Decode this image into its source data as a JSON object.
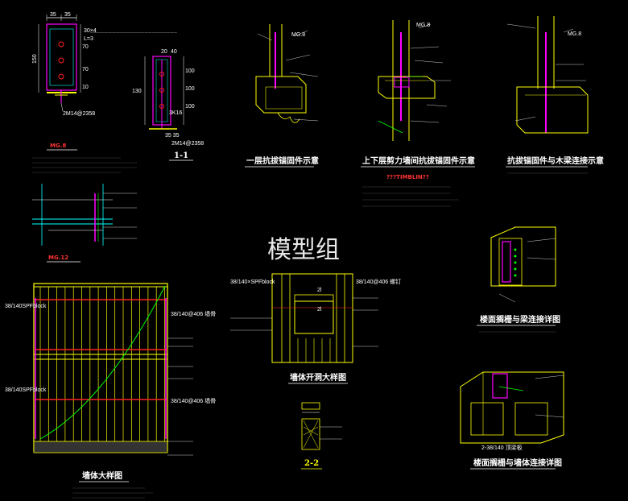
{
  "watermark": "模型组",
  "mg8": {
    "title": "MG.8",
    "dims_top": [
      "35",
      "35"
    ],
    "dims_side": [
      "70",
      "70",
      "10"
    ],
    "height": "150",
    "callout": "2M14@2358",
    "small": "L=3",
    "anno": "30×4"
  },
  "sec11": {
    "title": "1-1",
    "dims_top": [
      "20",
      "40"
    ],
    "dims_side": [
      "100",
      "100",
      "100"
    ],
    "left": "130",
    "callout": "2M14@2358",
    "small": "3K16",
    "bottom": "35 35"
  },
  "mg12": {
    "title": "MG.12"
  },
  "diag1": {
    "title": "一层抗拔锚固件示意",
    "tag": "MG.8"
  },
  "diag2": {
    "title": "上下层剪力墙间抗拔锚固件示意",
    "tag": "MG.8",
    "red_note": "???TIMBLIN??"
  },
  "diag3": {
    "title": "抗拔锚固件与木梁连接示意",
    "tag": "MG.8"
  },
  "opening": {
    "title": "墙体开洞大样图",
    "label_left": "38/140×SPFblock",
    "label_right": "38/140@406 螺钉",
    "mark_a": "2l",
    "mark_b": "2l"
  },
  "wall": {
    "title": "墙体大样图",
    "label_a": "38/140SPFblock",
    "label_b": "38/140SPFblock",
    "label_r1": "38/140@406 墙骨",
    "label_r2": "38/140@406 墙骨"
  },
  "sec22": {
    "title": "2-2"
  },
  "joist1": {
    "title": "楼面搁栅与梁连接详图"
  },
  "joist2": {
    "title": "楼面搁栅与墙体连接详图",
    "label": "2-38/140 顶梁板"
  },
  "colors": {
    "yellow": "#ffff00",
    "magenta": "#ff00ff",
    "green": "#00ff00",
    "cyan": "#00ffff",
    "red": "#ff2020",
    "white": "#ffffff"
  }
}
